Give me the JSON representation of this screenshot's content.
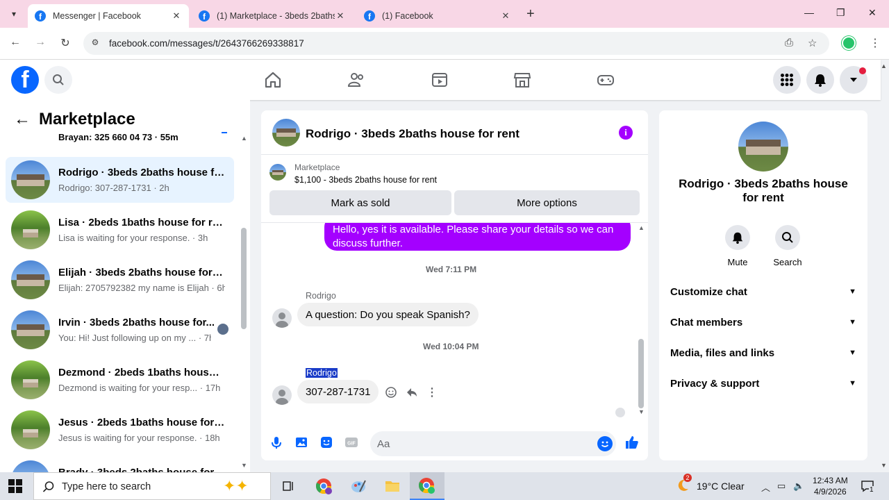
{
  "browser": {
    "tabs": [
      {
        "title": "Messenger | Facebook",
        "active": true
      },
      {
        "title": "(1) Marketplace - 3beds 2baths",
        "active": false
      },
      {
        "title": "(1) Facebook",
        "active": false
      }
    ],
    "url": "facebook.com/messages/t/2643766269338817"
  },
  "marketplace": {
    "title": "Marketplace",
    "conversations": [
      {
        "title": "",
        "subtitle": "Brayan: 325 660 04 73 · 55m",
        "unread": true
      },
      {
        "title": "Rodrigo · 3beds 2baths house fo...",
        "subtitle": "Rodrigo: 307-287-1731 · 2h",
        "active": true
      },
      {
        "title": "Lisa · 2beds 1baths house for rent",
        "subtitle": "Lisa is waiting for your response. · 3h"
      },
      {
        "title": "Elijah · 3beds 2baths house for r...",
        "subtitle": "Elijah: 2705792382 my name is Elijah · 6h"
      },
      {
        "title": "Irvin · 3beds 2baths house for...",
        "subtitle": "You: Hi! Just following up on my ... · 7h"
      },
      {
        "title": "Dezmond · 2beds 1baths house f...",
        "subtitle": "Dezmond is waiting for your resp...  · 17h"
      },
      {
        "title": "Jesus · 2beds 1baths house for r...",
        "subtitle": "Jesus is waiting for your response. · 18h"
      },
      {
        "title": "Brady · 3beds 2baths house for r...",
        "subtitle": ""
      }
    ]
  },
  "chat": {
    "title": "Rodrigo · 3beds 2baths house for rent",
    "marketplace_label": "Marketplace",
    "listing": "$1,100 - 3beds 2baths house for rent",
    "mark_sold": "Mark as sold",
    "more_options": "More options",
    "outgoing_message": "Hello, yes it is available. Please share your details so we can discuss further.",
    "timestamp1": "Wed 7:11 PM",
    "sender1": "Rodrigo",
    "message1": "A question: Do you speak Spanish?",
    "timestamp2": "Wed 10:04 PM",
    "sender2": "Rodrigo",
    "message2": "307-287-1731",
    "composer_placeholder": "Aa"
  },
  "details": {
    "name": "Rodrigo · 3beds 2baths house for rent",
    "mute": "Mute",
    "search": "Search",
    "sections": [
      "Customize chat",
      "Chat members",
      "Media, files and links",
      "Privacy & support"
    ]
  },
  "taskbar": {
    "search_placeholder": "Type here to search",
    "weather": "19°C  Clear",
    "weather_badge": "2",
    "time": "12:43 AM",
    "date": "4/9/2026",
    "notifications": "1"
  },
  "colors": {
    "facebook_blue": "#0866ff",
    "messenger_purple": "#a400ff",
    "active_conversation": "#e7f3ff"
  }
}
